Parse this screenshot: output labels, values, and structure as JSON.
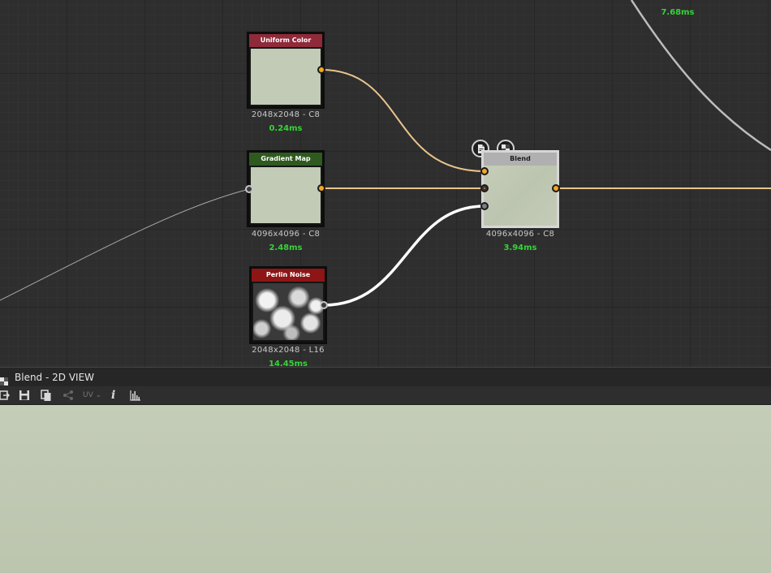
{
  "graph": {
    "nodes": [
      {
        "id": "uniform",
        "title": "Uniform Color",
        "resolution": "2048x2048 - C8",
        "time": "0.24ms",
        "header_color": "#8f2a3a"
      },
      {
        "id": "gradient",
        "title": "Gradient Map",
        "resolution": "4096x4096 - C8",
        "time": "2.48ms",
        "header_color": "#2f5a1f"
      },
      {
        "id": "perlin",
        "title": "Perlin Noise",
        "resolution": "2048x2048 - L16",
        "time": "14.45ms",
        "header_color": "#8e1515"
      },
      {
        "id": "blend",
        "title": "Blend",
        "resolution": "4096x4096 - C8",
        "time": "3.94ms",
        "header_color": "#b0b0b0"
      }
    ],
    "offscreen_time": "7.68ms"
  },
  "view": {
    "title": "Blend - 2D VIEW",
    "uv_label": "UV"
  },
  "colors": {
    "time_green": "#37d337",
    "port_orange": "#f5a623",
    "preview_bg": "#c2cbb6"
  }
}
